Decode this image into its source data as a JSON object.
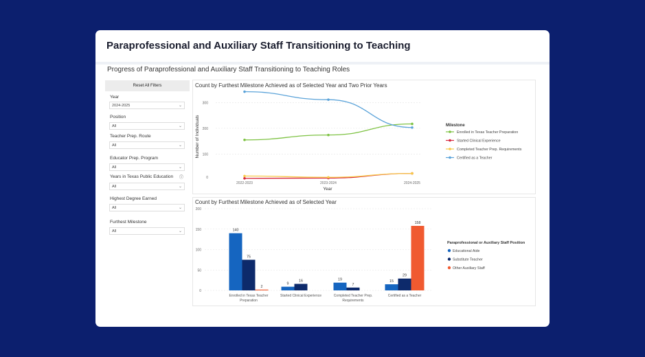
{
  "header": {
    "title": "Paraprofessional and Auxiliary Staff Transitioning to Teaching"
  },
  "subtitle": "Progress of Paraprofessional and Auxiliary Staff Transitioning to Teaching Roles",
  "filters": {
    "reset_label": "Reset All Filters",
    "items": [
      {
        "label": "Year",
        "value": "2024-2025"
      },
      {
        "label": "Position",
        "value": "All"
      },
      {
        "label": "Teacher Prep. Route",
        "value": "All"
      },
      {
        "label": "Educator Prep. Program",
        "value": "All"
      },
      {
        "label": "Years in Texas Public Education",
        "value": "All"
      },
      {
        "label": "Highest Degree Earned",
        "value": "All"
      },
      {
        "label": "Furthest Milestone",
        "value": "All"
      }
    ]
  },
  "colors": {
    "background": "#0c1f6e",
    "green": "#7dc242",
    "red": "#d7263d",
    "yellow": "#f7c948",
    "blue_line": "#5ba3d9",
    "bar_aide": "#1565c0",
    "bar_sub": "#0d2a6b",
    "bar_other": "#f05a30"
  },
  "chart_data": [
    {
      "type": "line",
      "title": "Count by Furthest Milestone Achieved as of Selected Year and Two Prior Years",
      "xlabel": "Year",
      "ylabel": "Number of Individuals",
      "x": [
        "2022-2023",
        "2023-2024",
        "2024-2025"
      ],
      "yticks": [
        100,
        200,
        300
      ],
      "ylim": [
        0,
        370
      ],
      "legend_title": "Milestone",
      "legend_position": "right",
      "series": [
        {
          "name": "Enrolled in Texas Teacher Preparation",
          "color": "#7dc242",
          "values": [
            155,
            174,
            217
          ]
        },
        {
          "name": "Started Clinical Experience",
          "color": "#d7263d",
          "values": [
            6,
            7,
            25
          ]
        },
        {
          "name": "Completed Teacher Prep. Requirements",
          "color": "#f7c948",
          "values": [
            15,
            10,
            25
          ]
        },
        {
          "name": "Certified as a Teacher",
          "color": "#5ba3d9",
          "values": [
            342,
            311,
            203
          ]
        }
      ]
    },
    {
      "type": "bar",
      "title": "Count by Furthest Milestone Achieved as of Selected Year",
      "categories": [
        "Enrolled in Texas Teacher Preparation",
        "Started Clinical Experience",
        "Completed Teacher Prep. Requirements",
        "Certified as a Teacher"
      ],
      "yticks": [
        0,
        50,
        100,
        150,
        200
      ],
      "ylim": [
        0,
        200
      ],
      "legend_title": "Paraprofessional or Auxiliary Staff Position",
      "legend_position": "right",
      "series": [
        {
          "name": "Educational Aide",
          "color": "#1565c0",
          "values": [
            140,
            9,
            19,
            15
          ]
        },
        {
          "name": "Substitute Teacher",
          "color": "#0d2a6b",
          "values": [
            75,
            16,
            7,
            29
          ]
        },
        {
          "name": "Other Auxiliary Staff",
          "color": "#f05a30",
          "values": [
            2,
            0,
            0,
            158
          ]
        }
      ]
    }
  ]
}
